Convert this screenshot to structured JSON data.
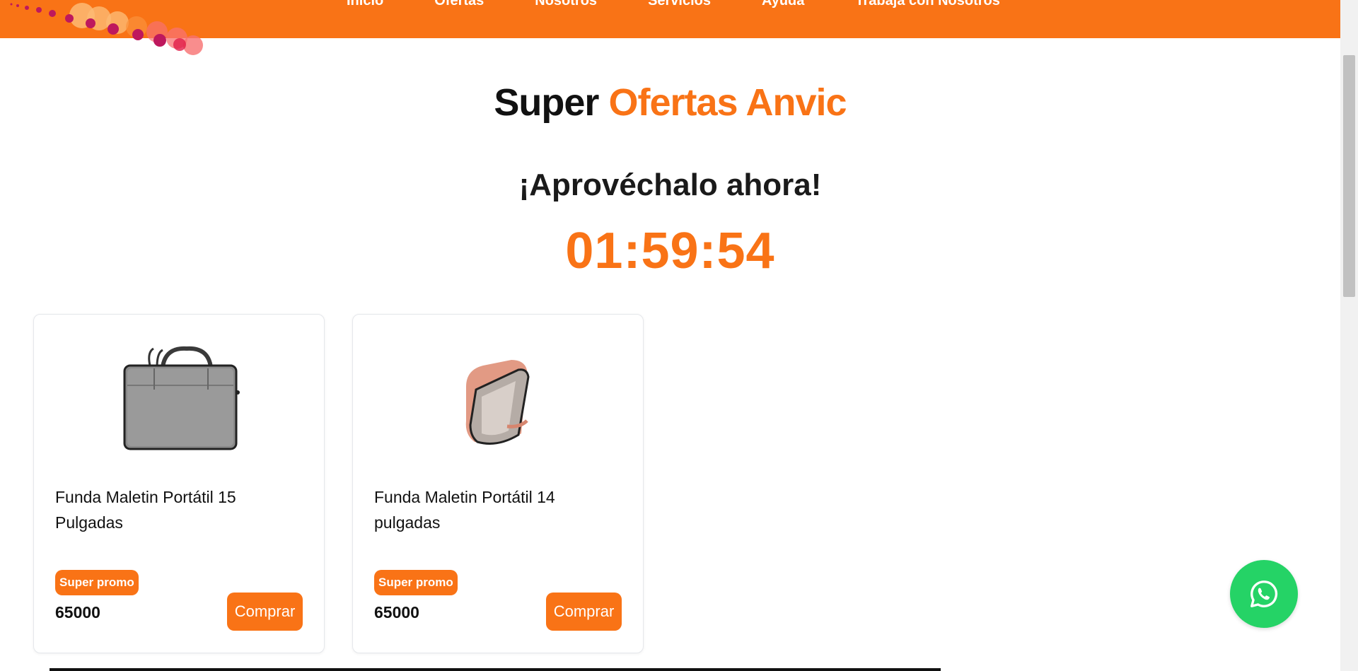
{
  "nav": {
    "items": [
      "Inicio",
      "Ofertas",
      "Nosotros",
      "Servicios",
      "Ayuda",
      "Trabaja con Nosotros"
    ]
  },
  "hero": {
    "title_part1": "Super",
    "title_part2": "Ofertas Anvic",
    "subtitle": "¡Aprovéchalo ahora!",
    "countdown": "01:59:54"
  },
  "products": [
    {
      "title": "Funda Maletin Portátil 15 Pulgadas",
      "badge": "Super promo",
      "price": "65000",
      "button": "Comprar",
      "image": "grey-laptop-bag"
    },
    {
      "title": "Funda Maletin Portátil 14 pulgadas",
      "badge": "Super promo",
      "price": "65000",
      "button": "Comprar",
      "image": "pink-laptop-sleeve"
    }
  ],
  "colors": {
    "accent": "#f97316",
    "whatsapp": "#25d366"
  },
  "icons": {
    "floating": "whatsapp-icon"
  }
}
